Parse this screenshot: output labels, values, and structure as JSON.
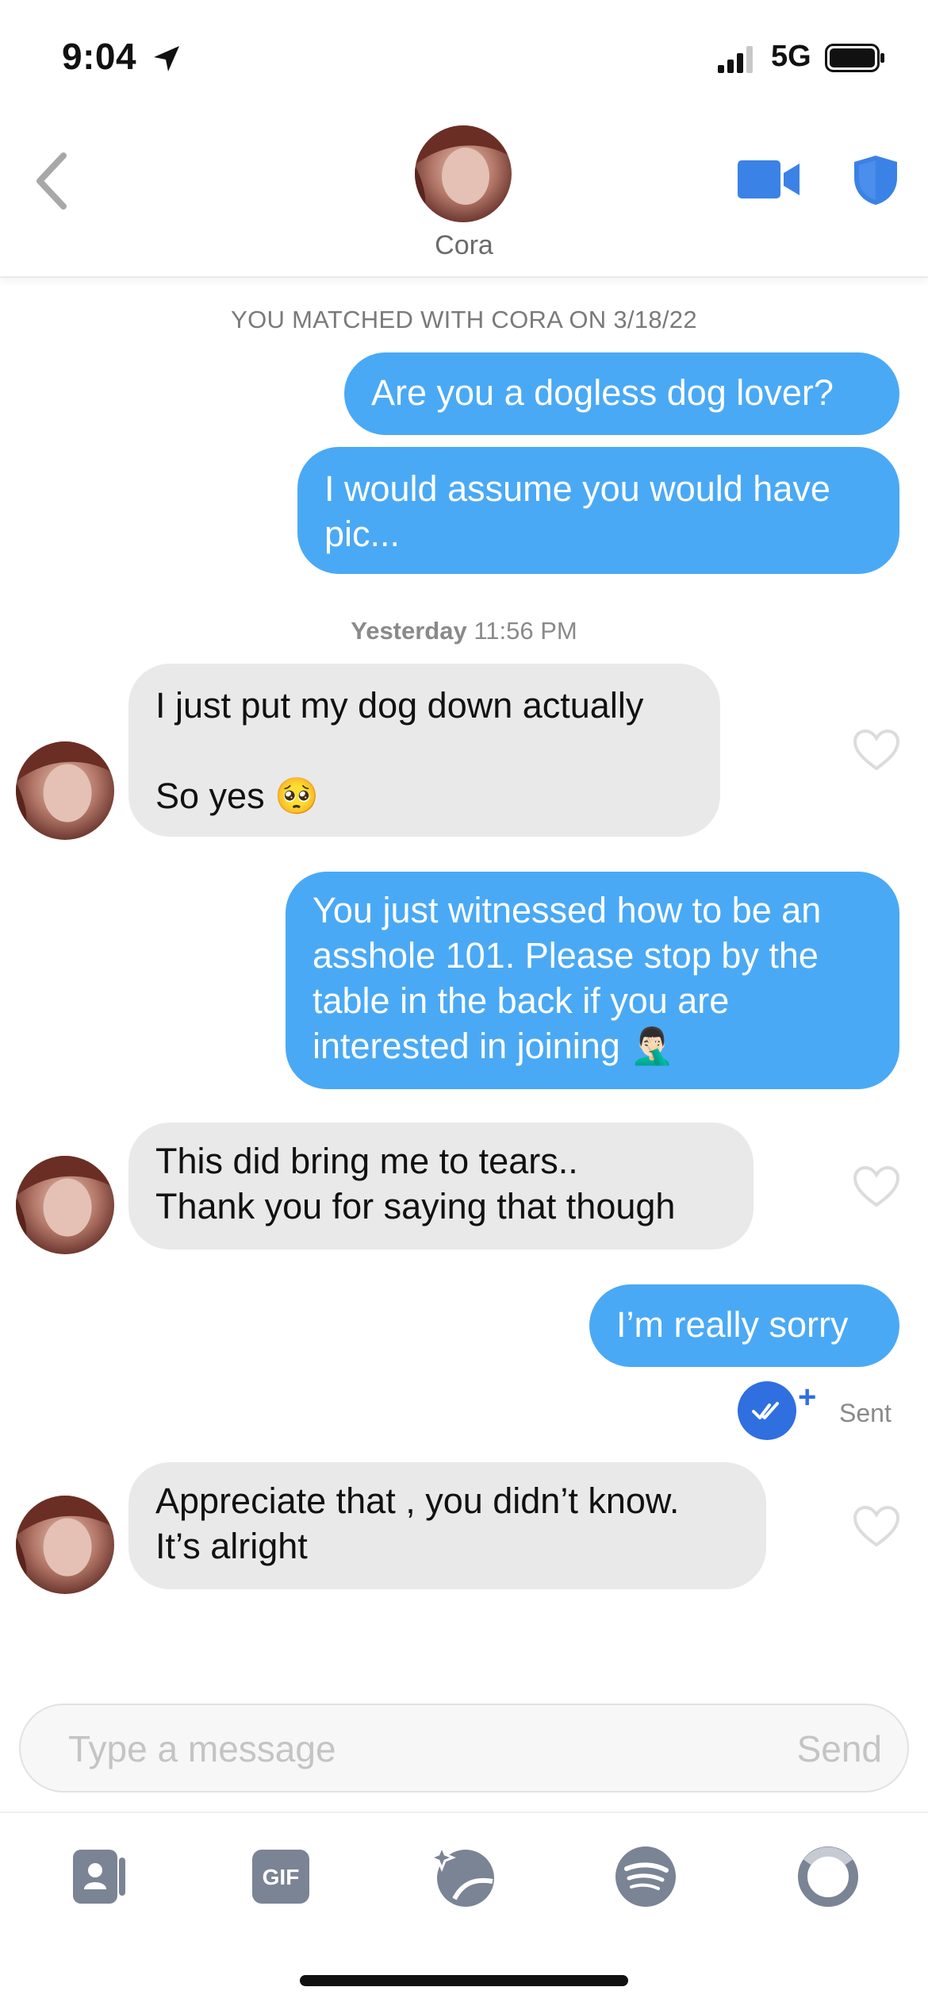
{
  "status_bar": {
    "time": "9:04",
    "network": "5G"
  },
  "header": {
    "name": "Cora"
  },
  "chat": {
    "match_banner": "YOU MATCHED WITH CORA ON 3/18/22",
    "timestamp_day": "Yesterday",
    "timestamp_time": "11:56 PM",
    "messages": [
      {
        "from": "me",
        "text": "Are you a dogless dog lover?"
      },
      {
        "from": "me",
        "text": "I would assume you would have\npic..."
      },
      {
        "from": "them",
        "text": "I just put my dog down actually\n\nSo yes 🥺"
      },
      {
        "from": "me",
        "text": "You just witnessed how to be an\nasshole 101. Please stop by the\ntable in the back if you are\ninterested in joining 🤦🏻‍♂️"
      },
      {
        "from": "them",
        "text": "This did bring me to tears..\nThank you for saying that though"
      },
      {
        "from": "me",
        "text": "I’m really sorry"
      },
      {
        "from": "them",
        "text": "Appreciate that , you didn’t know.\nIt’s alright"
      }
    ],
    "read_plus": "+",
    "sent_label": "Sent"
  },
  "composer": {
    "placeholder": "Type a message",
    "send_label": "Send"
  },
  "toolbar": {
    "gif_label": "GIF"
  },
  "colors": {
    "outgoing": "#4aa9f5",
    "incoming": "#e9e9e9",
    "accent": "#3b82e6"
  },
  "icons": [
    "location-arrow-icon",
    "signal-icon",
    "battery-icon",
    "back-chevron-icon",
    "video-call-icon",
    "shield-icon",
    "heart-icon",
    "read-receipt-icon",
    "contact-card-icon",
    "gif-icon",
    "sticker-icon",
    "spotify-icon",
    "loading-ring-icon"
  ]
}
